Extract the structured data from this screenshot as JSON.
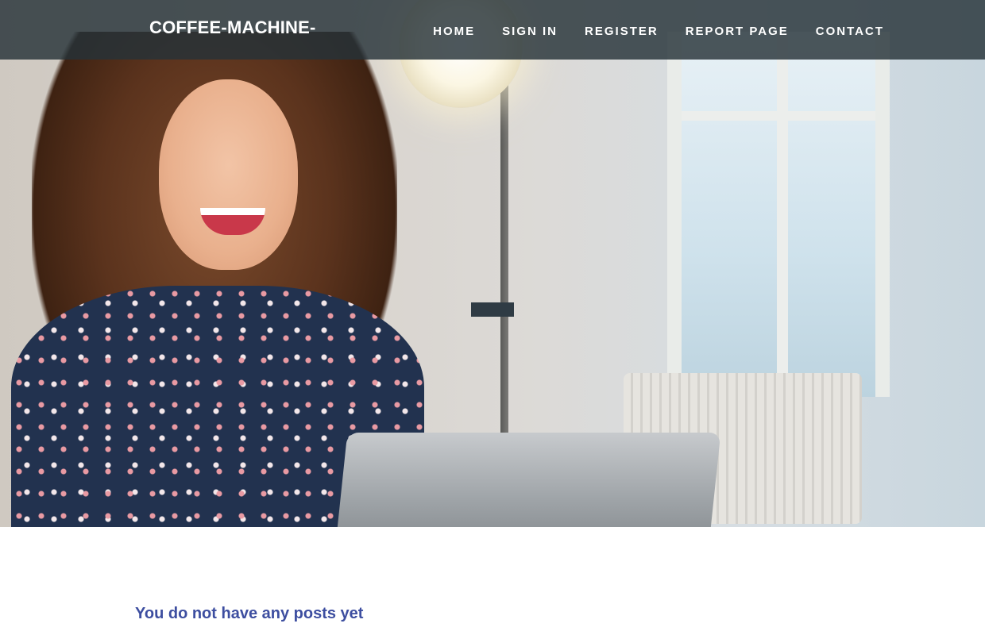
{
  "site": {
    "brand": "COFFEE-MACHINE-"
  },
  "nav": {
    "items": [
      {
        "label": "HOME"
      },
      {
        "label": "SIGN IN"
      },
      {
        "label": "REGISTER"
      },
      {
        "label": "REPORT PAGE"
      },
      {
        "label": "CONTACT"
      }
    ]
  },
  "hero": {
    "image": "woman-with-laptop-photo"
  },
  "main": {
    "empty_message": "You do not have any posts yet"
  },
  "colors": {
    "navbar": "#263238",
    "message": "#3d4ea0",
    "hero_tag": "#2f3b44"
  }
}
